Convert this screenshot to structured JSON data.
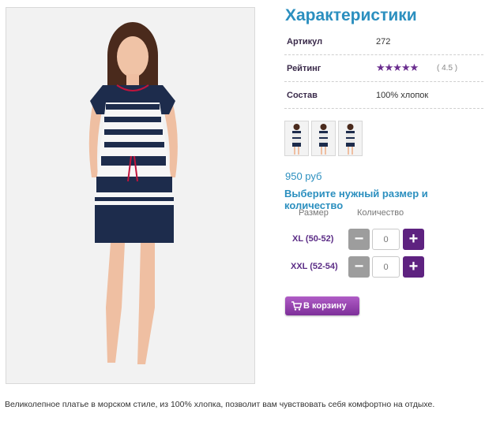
{
  "main_image": {
    "alt": "Женщина в полосатом платье",
    "icon": "product-photo"
  },
  "section_title": "Характеристики",
  "specs": [
    {
      "key": "Артикул",
      "value": "272"
    },
    {
      "key": "Рейтинг",
      "value": "( 4.5 )",
      "stars": "★★★★★",
      "rating": 4.5
    },
    {
      "key": "Состав",
      "value": "100% хлопок"
    }
  ],
  "thumbnails": [
    "thumb-front",
    "thumb-back",
    "thumb-side"
  ],
  "price": "950 руб",
  "choose_label": "Выберите нужный размер и количество",
  "table_headers": {
    "size": "Размер",
    "qty": "Количество"
  },
  "sizes": [
    {
      "label": "XL (50-52)",
      "qty": "0"
    },
    {
      "label": "XXL (52-54)",
      "qty": "0"
    }
  ],
  "controls": {
    "minus": "−",
    "plus": "+"
  },
  "cart_button": "В корзину",
  "description": "Великолепное платье в морском стиле, из 100% хлопка, позволит вам чувствовать себя комфортно на отдыхе.",
  "colors": {
    "accent_blue": "#2b8fbf",
    "purple": "#5e2280",
    "gray_button": "#9d9d9d"
  }
}
